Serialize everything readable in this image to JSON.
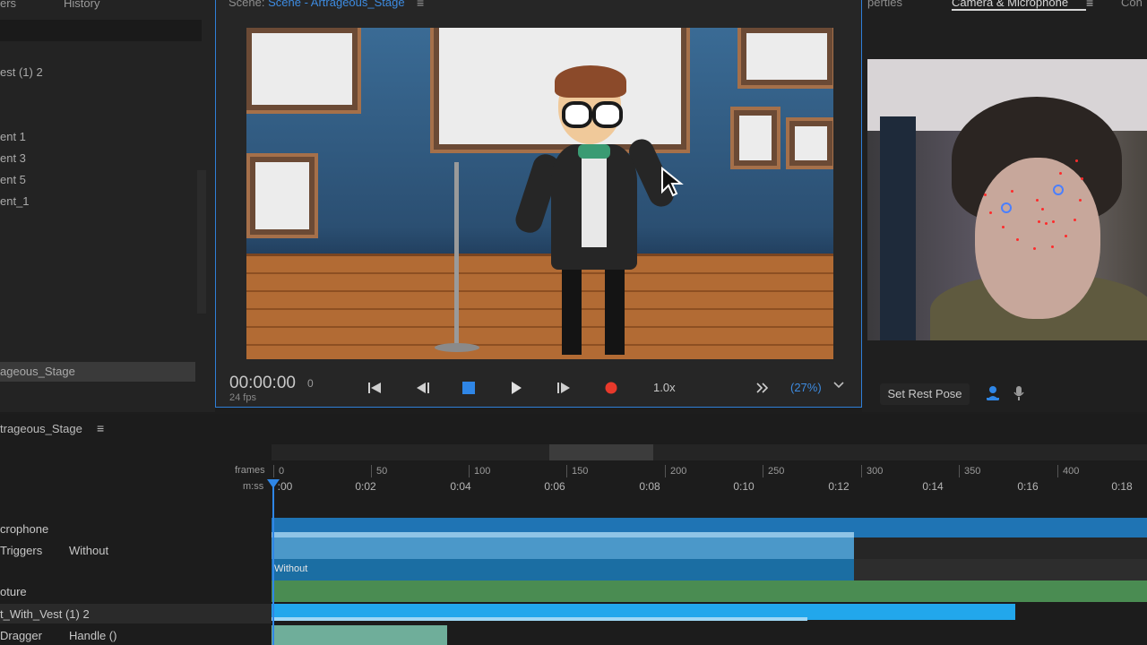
{
  "left_panel": {
    "tabs": [
      "ers",
      "History"
    ],
    "items": [
      "est (1) 2",
      "ent 1",
      "ent 3",
      "ent 5",
      "ent_1"
    ],
    "selected": "ageous_Stage"
  },
  "scene": {
    "title_prefix": "Scene: ",
    "title_name": "Scene - Artrageous_Stage",
    "menu_icon": "≡",
    "timecode": "00:00:00",
    "frame": "0",
    "fps": "24 fps",
    "speed": "1.0x",
    "zoom": "(27%)",
    "icons": {
      "go_start": "skip-to-start-icon",
      "step_back": "step-back-icon",
      "stop": "stop-icon",
      "play": "play-icon",
      "step_forward": "step-forward-icon",
      "record": "record-icon",
      "more": "double-chevron-right-icon",
      "zoom_dropdown": "chevron-down-icon"
    },
    "colors": {
      "accent": "#2f7fd8",
      "record": "#e8392b",
      "stop": "#2f86e6"
    }
  },
  "camera_panel": {
    "tab_properties": "perties",
    "tab_camera": "Camera & Microphone",
    "tab_menu": "≡",
    "tab_controls": "Con",
    "set_rest_pose": "Set Rest Pose",
    "icons": {
      "user": "user-icon",
      "mic": "microphone-icon"
    }
  },
  "timeline": {
    "title": "trageous_Stage",
    "menu_icon": "≡",
    "frames_label": "frames",
    "mss_label": "m:ss",
    "frame_ticks": [
      "0",
      "50",
      "100",
      "150",
      "200",
      "250",
      "300",
      "350",
      "400"
    ],
    "time_ticks": [
      ":00",
      "0:02",
      "0:04",
      "0:06",
      "0:08",
      "0:10",
      "0:12",
      "0:14",
      "0:16",
      "0:18"
    ],
    "playhead_time": ":00",
    "rows": [
      {
        "label": "crophone",
        "label2": ""
      },
      {
        "label": "Triggers",
        "label2": "Without"
      },
      {
        "label": "",
        "label2": "",
        "bar_text": "Without"
      },
      {
        "label": "oture",
        "label2": ""
      },
      {
        "label": "t_With_Vest (1) 2",
        "label2": ""
      },
      {
        "label": "Dragger",
        "label2": "Handle ()"
      }
    ]
  }
}
